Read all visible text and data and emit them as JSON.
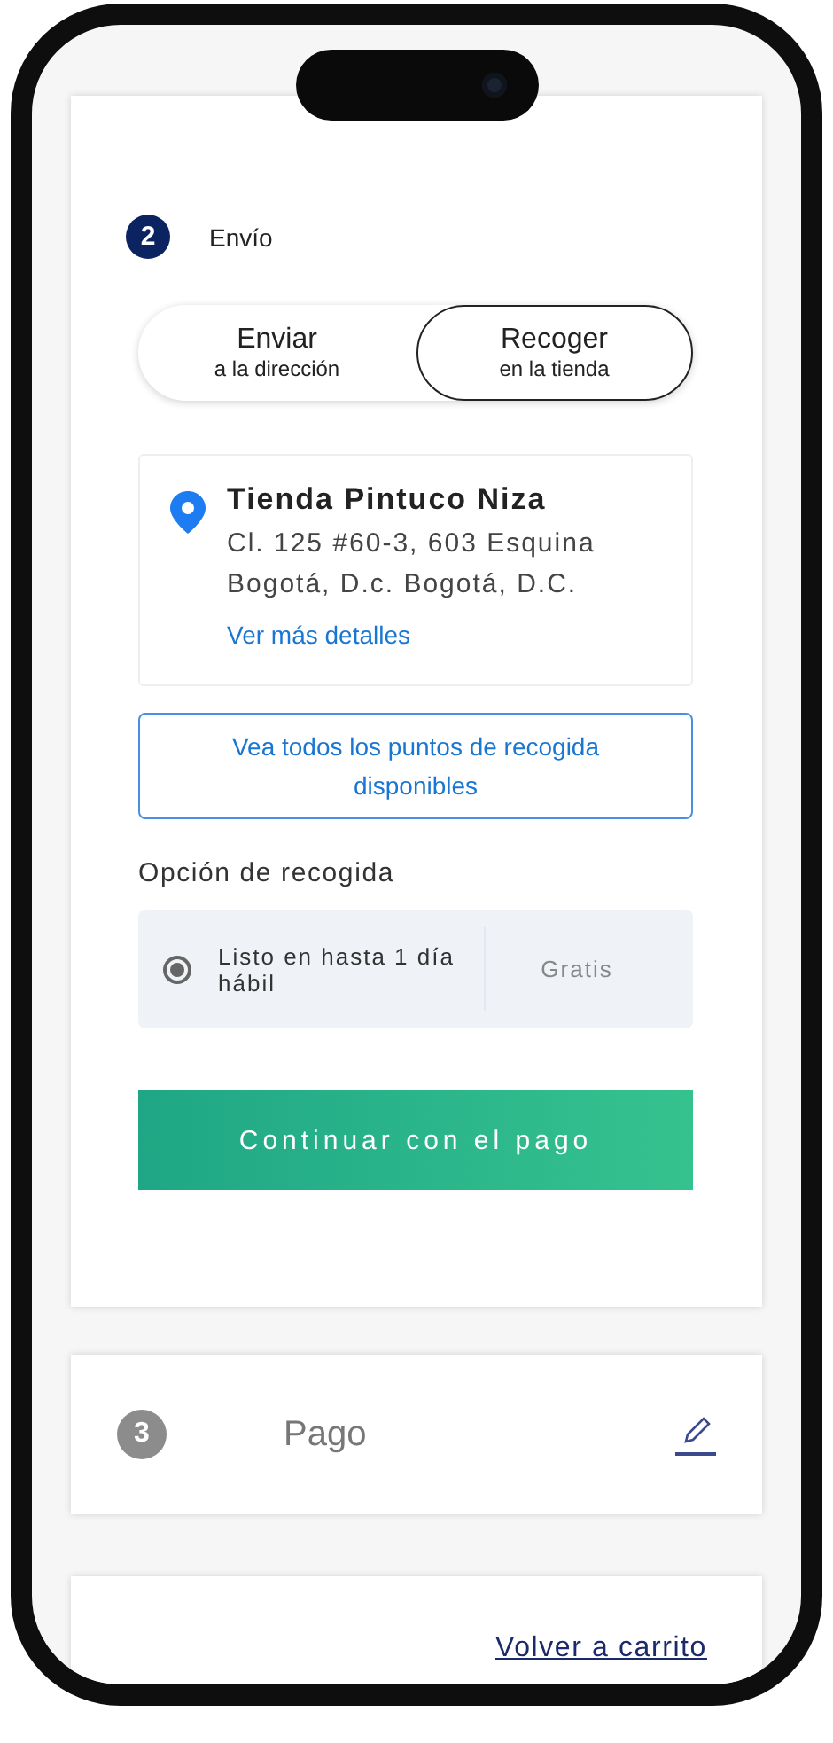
{
  "shipping_step": {
    "number": "2",
    "title": "Envío",
    "active": true
  },
  "delivery_options": [
    {
      "title": "Enviar",
      "subtitle": "a la dirección",
      "selected": false
    },
    {
      "title": "Recoger",
      "subtitle": "en la tienda",
      "selected": true
    }
  ],
  "store": {
    "name": "Tienda Pintuco Niza",
    "address_line_1": "Cl. 125 #60-3, 603 Esquina",
    "address_line_2": "Bogotá, D.c. Bogotá, D.C.",
    "details_link": "Ver más detalles"
  },
  "all_points_button": "Vea todos los puntos de recogida disponibles",
  "pickup_label": "Opción de recogida",
  "pickup_options": [
    {
      "label": "Listo en hasta 1 día hábil",
      "price": "Gratis",
      "selected": true
    }
  ],
  "continue_button": "Continuar con el pago",
  "payment_step": {
    "number": "3",
    "title": "Pago",
    "active": false
  },
  "back_link": "Volver a carrito"
}
